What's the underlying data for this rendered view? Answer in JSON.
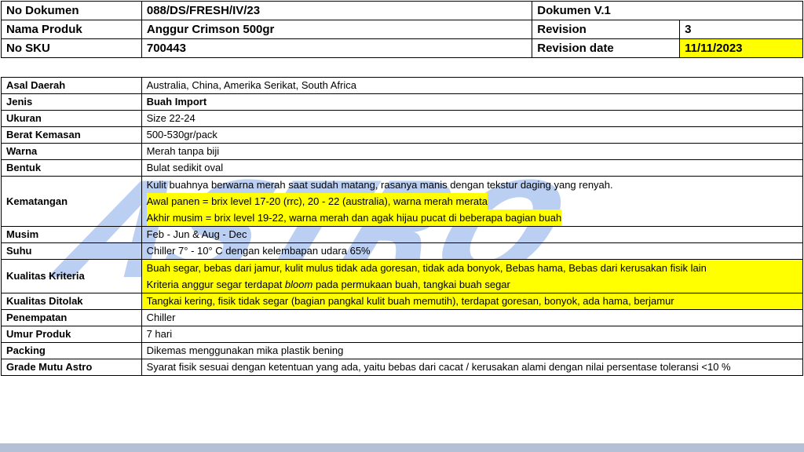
{
  "watermark": {
    "text": "ASTRO",
    "color": "#82a8e8"
  },
  "header": {
    "no_dokumen_label": "No Dokumen",
    "no_dokumen_value": "088/DS/FRESH/IV/23",
    "dokumen_version": "Dokumen V.1",
    "nama_produk_label": "Nama Produk",
    "nama_produk_value": "Anggur Crimson 500gr",
    "revision_label": "Revision",
    "revision_value": "3",
    "no_sku_label": "No SKU",
    "no_sku_value": "700443",
    "revision_date_label": "Revision date",
    "revision_date_value": "11/11/2023",
    "highlight_color": "#ffff00"
  },
  "spec": {
    "asal_daerah": {
      "label": "Asal Daerah",
      "value": "Australia, China, Amerika Serikat, South Africa"
    },
    "jenis": {
      "label": "Jenis",
      "value": "Buah Import"
    },
    "ukuran": {
      "label": "Ukuran",
      "value": "Size 22-24"
    },
    "berat_kemasan": {
      "label": "Berat Kemasan",
      "value": "500-530gr/pack"
    },
    "warna": {
      "label": "Warna",
      "value": "Merah tanpa biji"
    },
    "bentuk": {
      "label": "Bentuk",
      "value": "Bulat sedikit oval"
    },
    "kematangan": {
      "label": "Kematangan",
      "line1": "Kulit buahnya berwarna merah saat sudah matang, rasanya manis dengan tekstur daging yang renyah.",
      "line2": "Awal panen = brix level 17-20 (rrc), 20 - 22 (australia), warna merah merata",
      "line3": "Akhir musim = brix level 19-22, warna merah dan agak hijau pucat di beberapa bagian buah"
    },
    "musim": {
      "label": "Musim",
      "value": "Feb -  Jun & Aug - Dec"
    },
    "suhu": {
      "label": "Suhu",
      "value": "Chiller 7° - 10° C dengan kelembapan udara 65%"
    },
    "kualitas_kriteria": {
      "label": "Kualitas Kriteria",
      "line1": "Buah segar, bebas dari jamur, kulit mulus tidak ada goresan, tidak ada bonyok, Bebas hama, Bebas dari kerusakan fisik lain",
      "line2_pre": "Kriteria anggur segar terdapat ",
      "line2_em": "bloom",
      "line2_post": " pada permukaan buah, tangkai buah segar"
    },
    "kualitas_ditolak": {
      "label": "Kualitas Ditolak",
      "value": "Tangkai kering, fisik tidak segar (bagian pangkal kulit buah memutih), terdapat goresan, bonyok, ada hama, berjamur"
    },
    "penempatan": {
      "label": "Penempatan",
      "value": "Chiller"
    },
    "umur_produk": {
      "label": "Umur Produk",
      "value": "7 hari"
    },
    "packing": {
      "label": "Packing",
      "value": "Dikemas menggunakan mika plastik bening"
    },
    "grade_mutu": {
      "label": "Grade Mutu Astro",
      "value": "Syarat fisik sesuai dengan ketentuan yang ada, yaitu bebas dari cacat / kerusakan alami dengan  nilai persentase toleransi <10 %"
    }
  }
}
